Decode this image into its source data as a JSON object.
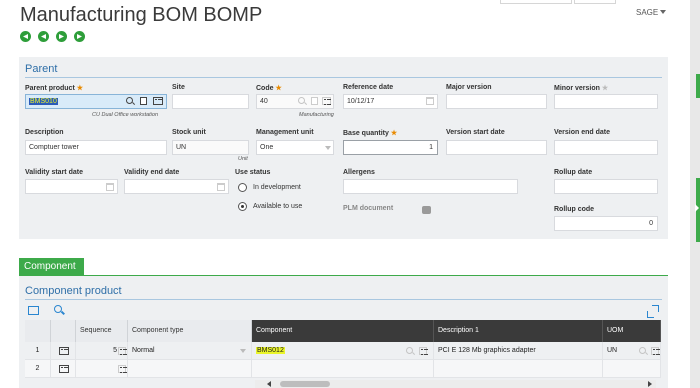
{
  "window": {
    "title": "Manufacturing BOM BOMP",
    "user_menu": "SAGE"
  },
  "nav": [
    "first-record",
    "previous-record",
    "next-record",
    "last-record"
  ],
  "parent": {
    "section_title": "Parent",
    "parent_product": {
      "label": "Parent product",
      "value": "BMS010",
      "description": "CU Dual Office workstation"
    },
    "site": {
      "label": "Site",
      "value": ""
    },
    "code": {
      "label": "Code",
      "value": "40",
      "description": "Manufacturing"
    },
    "reference_date": {
      "label": "Reference date",
      "value": "10/12/17"
    },
    "major_version": {
      "label": "Major version",
      "value": ""
    },
    "minor_version": {
      "label": "Minor version",
      "value": ""
    },
    "description": {
      "label": "Description",
      "value": "Comptuer tower"
    },
    "stock_unit": {
      "label": "Stock unit",
      "value": "UN",
      "sub": "Unit"
    },
    "management_unit": {
      "label": "Management unit",
      "value": "One"
    },
    "base_quantity": {
      "label": "Base quantity",
      "value": "1"
    },
    "version_start_date": {
      "label": "Version start date",
      "value": ""
    },
    "version_end_date": {
      "label": "Version end date",
      "value": ""
    },
    "validity_start_date": {
      "label": "Validity start date",
      "value": ""
    },
    "validity_end_date": {
      "label": "Validity end date",
      "value": ""
    },
    "use_status": {
      "label": "Use status",
      "options": [
        {
          "label": "In development",
          "selected": false
        },
        {
          "label": "Available to use",
          "selected": true
        }
      ]
    },
    "allergens": {
      "label": "Allergens",
      "value": ""
    },
    "plm_document": {
      "label": "PLM document"
    },
    "rollup_date": {
      "label": "Rollup date",
      "value": ""
    },
    "rollup_code": {
      "label": "Rollup code",
      "value": "0"
    }
  },
  "component_tab": {
    "label": "Component"
  },
  "component_product": {
    "section_title": "Component product",
    "columns": [
      "Sequence",
      "Component type",
      "Component",
      "Description 1",
      "UOM"
    ],
    "rows": [
      {
        "num": "1",
        "sequence": "5",
        "component_type": "Normal",
        "component": "BMS012",
        "description": "PCI E 128 Mb graphics adapter",
        "uom": "UN"
      },
      {
        "num": "2",
        "sequence": "",
        "component_type": "",
        "component": "",
        "description": "",
        "uom": ""
      }
    ]
  },
  "colors": {
    "accent_green": "#3daa4a",
    "section_blue": "#2f6fa8",
    "highlight_yellow": "#eaf52a",
    "grid_header_dark": "#3a3a3a"
  }
}
